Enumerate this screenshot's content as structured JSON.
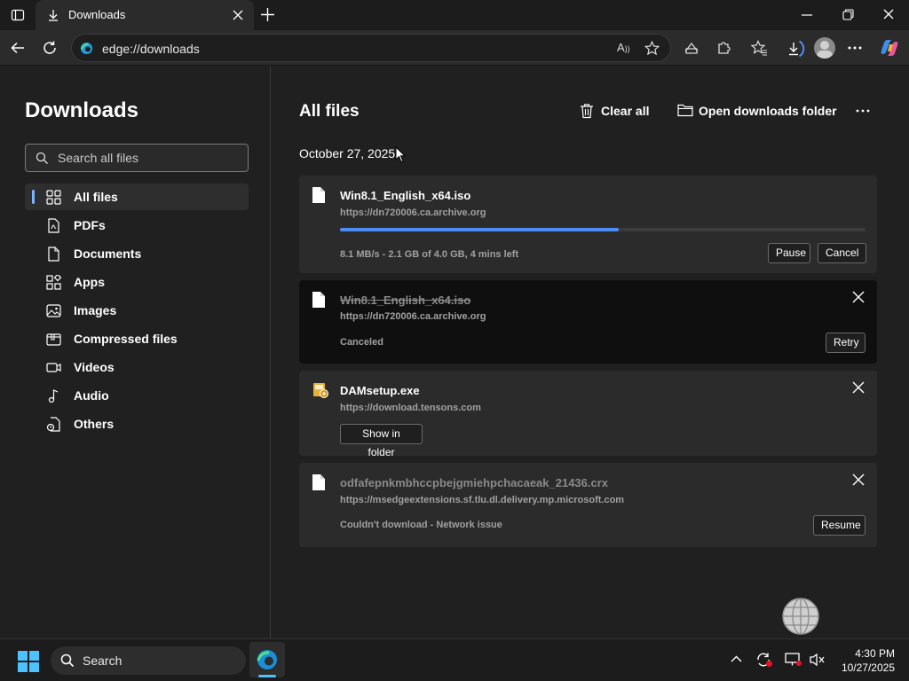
{
  "window": {
    "tab_title": "Downloads",
    "url": "edge://downloads"
  },
  "sidebar": {
    "title": "Downloads",
    "search_placeholder": "Search all files",
    "items": [
      {
        "label": "All files",
        "icon": "grid-icon",
        "active": true
      },
      {
        "label": "PDFs",
        "icon": "pdf-icon"
      },
      {
        "label": "Documents",
        "icon": "document-icon"
      },
      {
        "label": "Apps",
        "icon": "apps-icon"
      },
      {
        "label": "Images",
        "icon": "image-icon"
      },
      {
        "label": "Compressed files",
        "icon": "archive-icon"
      },
      {
        "label": "Videos",
        "icon": "video-icon"
      },
      {
        "label": "Audio",
        "icon": "music-icon"
      },
      {
        "label": "Others",
        "icon": "other-file-icon"
      }
    ]
  },
  "content": {
    "title": "All files",
    "clear_all": "Clear all",
    "open_folder": "Open downloads folder",
    "date_header": "October 27, 2025"
  },
  "downloads": [
    {
      "name": "Win8.1_English_x64.iso",
      "url": "https://dn720006.ca.archive.org",
      "status": "8.1 MB/s - 2.1 GB of 4.0 GB, 4 mins left",
      "progress": 0.53,
      "buttons": [
        "Pause",
        "Cancel"
      ]
    },
    {
      "name": "Win8.1_English_x64.iso",
      "url": "https://dn720006.ca.archive.org",
      "status": "Canceled",
      "buttons": [
        "Retry"
      ]
    },
    {
      "name": "DAMsetup.exe",
      "url": "https://download.tensons.com",
      "buttons": [
        "Show in folder"
      ]
    },
    {
      "name": "odfafepnkmbhccpbejgmiehpchacaeak_21436.crx",
      "url": "https://msedgeextensions.sf.tlu.dl.delivery.mp.microsoft.com",
      "status": "Couldn't download - Network issue",
      "buttons": [
        "Resume"
      ]
    }
  ],
  "taskbar": {
    "search_label": "Search",
    "time": "4:30 PM",
    "date": "10/27/2025"
  },
  "colors": {
    "accent": "#4c8df5",
    "background": "#202020",
    "card": "#2b2b2b"
  }
}
